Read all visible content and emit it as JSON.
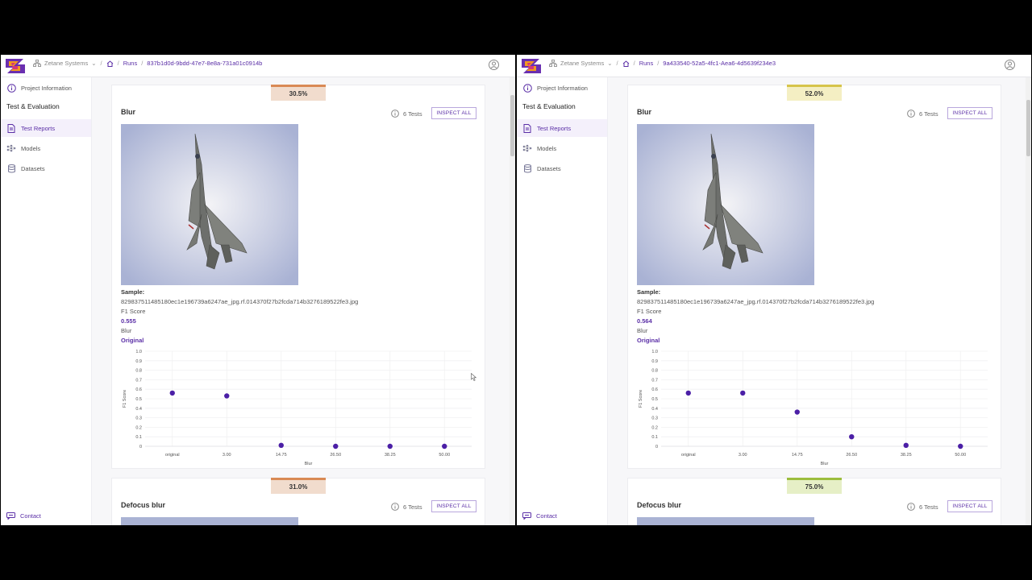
{
  "panes": [
    {
      "breadcrumb": {
        "org": "Zetane Systems",
        "runs": "Runs",
        "run_id": "837b1d0d-9bdd-47e7-8e8a-731a01c0914b"
      },
      "sidebar": {
        "project_info": "Project Information",
        "section": "Test & Evaluation",
        "items": [
          {
            "label": "Test Reports",
            "icon": "report-icon"
          },
          {
            "label": "Models",
            "icon": "model-icon"
          },
          {
            "label": "Datasets",
            "icon": "database-icon"
          }
        ],
        "contact": "Contact"
      },
      "cards": [
        {
          "badge": "30.5%",
          "badge_color": "#f1dccd",
          "badge_border": "#d98a55",
          "title": "Blur",
          "tests": "6 Tests",
          "inspect": "INSPECT ALL",
          "sample_label": "Sample:",
          "sample_file": "829837511485180ec1e196739a6247ae_jpg.rf.014370f27b2fcda714b3276189522fe3.jpg",
          "metric_label": "F1 Score",
          "metric_value": "0.555",
          "perturbation": "Blur",
          "original_label": "Original"
        },
        {
          "badge": "31.0%",
          "badge_color": "#f1dccd",
          "badge_border": "#d98a55",
          "title": "Defocus blur",
          "tests": "6 Tests",
          "inspect": "INSPECT ALL"
        }
      ],
      "chart_data": {
        "type": "scatter",
        "categories": [
          "original",
          "3.00",
          "14.75",
          "26.50",
          "38.25",
          "50.00"
        ],
        "values": [
          0.56,
          0.53,
          0.01,
          0.0,
          0.0,
          0.0
        ],
        "xlabel": "Blur",
        "ylabel": "F1 Score",
        "yticks": [
          "1.0",
          "0.9",
          "0.8",
          "0.7",
          "0.6",
          "0.5",
          "0.4",
          "0.3",
          "0.2",
          "0.1",
          "0"
        ],
        "ylim": [
          0,
          1.0
        ],
        "color": "#4b1fa6",
        "grid": true
      }
    },
    {
      "breadcrumb": {
        "org": "Zetane Systems",
        "runs": "Runs",
        "run_id": "9a433540-52a5-4fc1-Aea6-4d5639f234e3"
      },
      "sidebar": {
        "project_info": "Project Information",
        "section": "Test & Evaluation",
        "items": [
          {
            "label": "Test Reports",
            "icon": "report-icon"
          },
          {
            "label": "Models",
            "icon": "model-icon"
          },
          {
            "label": "Datasets",
            "icon": "database-icon"
          }
        ],
        "contact": "Contact"
      },
      "cards": [
        {
          "badge": "52.0%",
          "badge_color": "#f4efc3",
          "badge_border": "#d6c44a",
          "title": "Blur",
          "tests": "6 Tests",
          "inspect": "INSPECT ALL",
          "sample_label": "Sample:",
          "sample_file": "829837511485180ec1e196739a6247ae_jpg.rf.014370f27b2fcda714b3276189522fe3.jpg",
          "metric_label": "F1 Score",
          "metric_value": "0.564",
          "perturbation": "Blur",
          "original_label": "Original"
        },
        {
          "badge": "75.0%",
          "badge_color": "#e6efc6",
          "badge_border": "#9cbd3e",
          "title": "Defocus blur",
          "tests": "6 Tests",
          "inspect": "INSPECT ALL"
        }
      ],
      "chart_data": {
        "type": "scatter",
        "categories": [
          "original",
          "3.00",
          "14.75",
          "26.50",
          "38.25",
          "50.00"
        ],
        "values": [
          0.56,
          0.56,
          0.36,
          0.1,
          0.01,
          0.0
        ],
        "xlabel": "Blur",
        "ylabel": "F1 Score",
        "yticks": [
          "1.0",
          "0.9",
          "0.8",
          "0.7",
          "0.6",
          "0.5",
          "0.4",
          "0.3",
          "0.2",
          "0.1",
          "0"
        ],
        "ylim": [
          0,
          1.0
        ],
        "color": "#4b1fa6",
        "grid": true
      }
    }
  ]
}
